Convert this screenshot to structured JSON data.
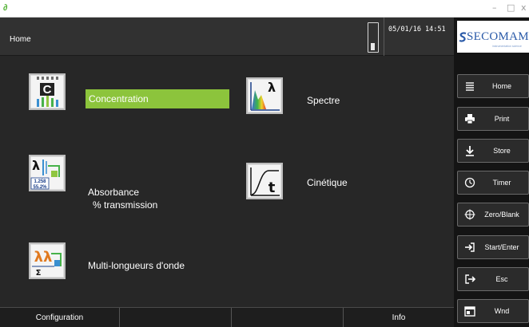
{
  "window": {
    "minimize_glyph": "–",
    "maximize_glyph": "□",
    "close_glyph": "x"
  },
  "header": {
    "title": "Home",
    "datetime": "05/01/16 14:51"
  },
  "tiles": [
    {
      "id": "concentration",
      "label": "Concentration",
      "selected": true,
      "icon": "concentration-icon",
      "icon_letter": "C"
    },
    {
      "id": "spectrum",
      "label": "Spectre",
      "selected": false,
      "icon": "spectrum-icon",
      "icon_letter": "λ"
    },
    {
      "id": "absorbance",
      "label_line1": "Absorbance",
      "label_line2": "% transmission",
      "selected": false,
      "icon": "absorbance-icon",
      "icon_letter": "λ",
      "icon_values": [
        "1.258",
        "55.2%"
      ]
    },
    {
      "id": "kinetics",
      "label": "Cinétique",
      "selected": false,
      "icon": "kinetics-icon",
      "icon_letter": "t"
    },
    {
      "id": "multiwave",
      "label": "Multi-longueurs d'onde",
      "selected": false,
      "icon": "multi-wavelength-icon",
      "icon_letter": "λλ",
      "icon_sub": "Σ"
    }
  ],
  "bottom_tabs": [
    {
      "label": "Configuration"
    },
    {
      "label": ""
    },
    {
      "label": ""
    },
    {
      "label": "Info"
    }
  ],
  "brand": {
    "name": "SECOMAM",
    "tagline": "instrumentation science"
  },
  "side_buttons": [
    {
      "label": "Home",
      "icon": "menu-icon"
    },
    {
      "label": "Print",
      "icon": "printer-icon"
    },
    {
      "label": "Store",
      "icon": "download-icon"
    },
    {
      "label": "Timer",
      "icon": "timer-icon"
    },
    {
      "label": "Zero/Blank",
      "icon": "crosshair-icon"
    },
    {
      "label": "Start/Enter",
      "icon": "enter-icon"
    },
    {
      "label": "Esc",
      "icon": "exit-icon"
    },
    {
      "label": "Wnd",
      "icon": "window-icon"
    }
  ],
  "colors": {
    "accent": "#8cc43c",
    "background": "#272727",
    "panel": "#141414",
    "brand": "#2a5aa8"
  }
}
